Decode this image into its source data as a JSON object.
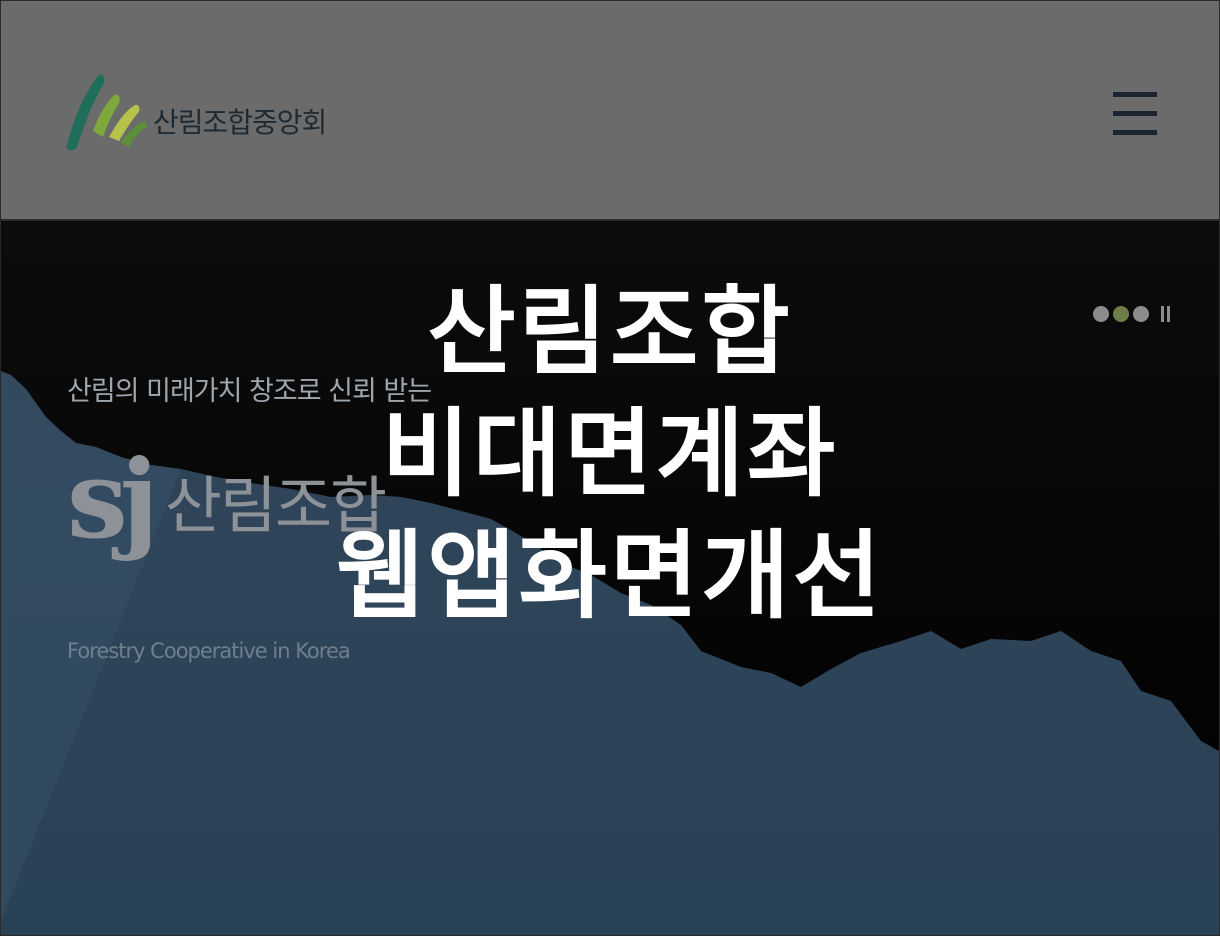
{
  "header": {
    "logo_text": "산림조합중앙회",
    "menu_icon": "hamburger-menu-icon"
  },
  "hero": {
    "tagline": "산림의 미래가치 창조로 신뢰 받는",
    "brand_mark": "sj",
    "brand_name": "산림조합",
    "subtitle": "Forestry Cooperative in Korea",
    "slider": {
      "dots": 3,
      "active_index": 1,
      "pause_icon": "pause-icon"
    }
  },
  "headline": {
    "lines": [
      "산림조합",
      "비대면계좌",
      "웹앱화면개선"
    ]
  },
  "colors": {
    "header_bg": "#6b6b6b",
    "hero_sky": "#2f4458",
    "mountain": "#050505",
    "logo_green": "#2e8b57",
    "active_dot": "#6f7d46"
  }
}
